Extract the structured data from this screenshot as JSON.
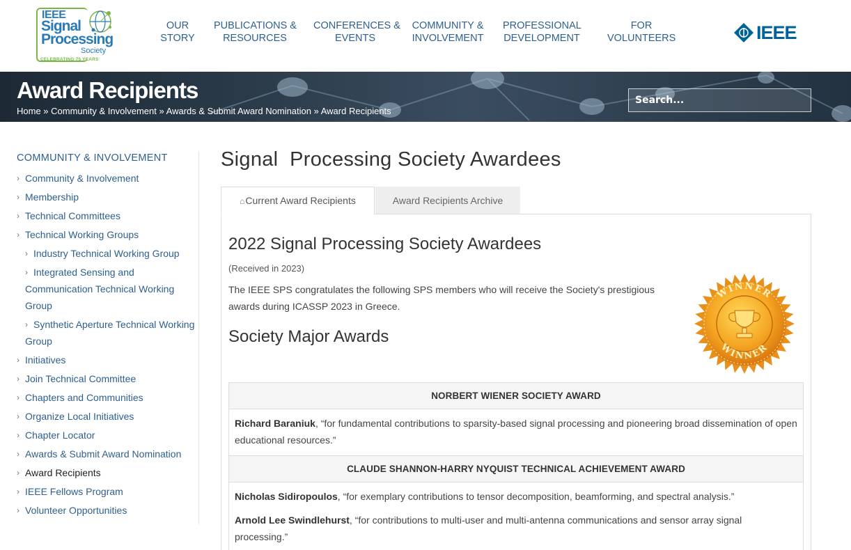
{
  "header": {
    "logo": {
      "ieee": "IEEE",
      "line1": "Signal",
      "line2": "Processing",
      "line3": "Society",
      "tagline": "CELEBRATING 75 YEARS"
    },
    "nav": [
      {
        "line1": "OUR",
        "line2": "STORY"
      },
      {
        "line1": "PUBLICATIONS &",
        "line2": "RESOURCES"
      },
      {
        "line1": "CONFERENCES &",
        "line2": "EVENTS"
      },
      {
        "line1": "COMMUNITY &",
        "line2": "INVOLVEMENT"
      },
      {
        "line1": "PROFESSIONAL",
        "line2": "DEVELOPMENT"
      },
      {
        "line1": "FOR",
        "line2": "VOLUNTEERS"
      }
    ],
    "ieee_brand": "IEEE"
  },
  "banner": {
    "title": "Award Recipients",
    "breadcrumb": [
      "Home",
      "Community & Involvement",
      "Awards & Submit Award Nomination",
      "Award Recipients"
    ],
    "breadcrumb_sep": " » ",
    "search_placeholder": "Search..."
  },
  "sidebar": {
    "title": "COMMUNITY & INVOLVEMENT",
    "items": [
      {
        "label": "Community & Involvement",
        "level": 0
      },
      {
        "label": "Membership",
        "level": 0
      },
      {
        "label": "Technical Committees",
        "level": 0
      },
      {
        "label": "Technical Working Groups",
        "level": 0
      },
      {
        "label": "Industry Technical Working Group",
        "level": 1
      },
      {
        "label": "Integrated Sensing and Communication Technical Working Group",
        "level": 1
      },
      {
        "label": "Synthetic Aperture Technical Working Group",
        "level": 1
      },
      {
        "label": "Initiatives",
        "level": 0
      },
      {
        "label": "Join Technical Committee",
        "level": 0
      },
      {
        "label": "Chapters and Communities",
        "level": 0
      },
      {
        "label": "Organize Local Initiatives",
        "level": 0
      },
      {
        "label": "Chapter Locator",
        "level": 0
      },
      {
        "label": "Awards & Submit Award Nomination",
        "level": 0
      },
      {
        "label": "Award Recipients",
        "level": 0,
        "active": true
      },
      {
        "label": "IEEE Fellows Program",
        "level": 0
      },
      {
        "label": "Volunteer Opportunities",
        "level": 0
      }
    ]
  },
  "main": {
    "title": "Signal  Processing Society Awardees",
    "tabs": [
      {
        "label": "Current Award Recipients",
        "active": true
      },
      {
        "label": "Award Recipients Archive",
        "active": false
      }
    ],
    "heading": "2022 Signal Processing Society Awardees",
    "received": "(Received in 2023)",
    "intro": "The IEEE SPS congratulates the following SPS members who will receive the Society's prestigious awards during ICASSP 2023 in Greece.",
    "subheading": "Society Major Awards",
    "seal_text": "WINNER",
    "awards": [
      {
        "name": "NORBERT WIENER SOCIETY AWARD",
        "recipients": [
          {
            "name": "Richard Baraniuk",
            "citation": ", “for fundamental contributions to sparsity-based signal processing and pioneering broad dissemination of open educational resources.”"
          }
        ]
      },
      {
        "name": "CLAUDE SHANNON-HARRY NYQUIST TECHNICAL ACHIEVEMENT AWARD",
        "recipients": [
          {
            "name": "Nicholas Sidiropoulos",
            "citation": ", “for exemplary contributions to tensor decomposition, beamforming, and spectral analysis.”"
          },
          {
            "name": "Arnold Lee Swindlehurst",
            "citation": ", “for contributions to multi-user and multi-antenna communications and sensor array signal processing.”"
          }
        ]
      }
    ]
  },
  "colors": {
    "nav": "#2d5f8f",
    "ieee_blue": "#00629b",
    "logo_green": "#7ab648",
    "seal_gold": "#f0a418"
  }
}
